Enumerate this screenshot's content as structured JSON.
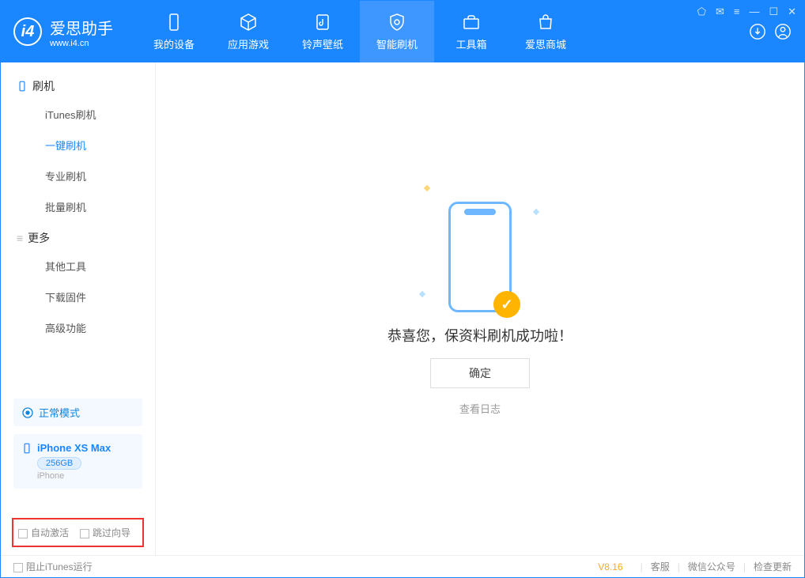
{
  "app": {
    "name": "爱思助手",
    "url": "www.i4.cn"
  },
  "tabs": [
    {
      "label": "我的设备"
    },
    {
      "label": "应用游戏"
    },
    {
      "label": "铃声壁纸"
    },
    {
      "label": "智能刷机"
    },
    {
      "label": "工具箱"
    },
    {
      "label": "爱思商城"
    }
  ],
  "sidebar": {
    "group1": "刷机",
    "items1": [
      "iTunes刷机",
      "一键刷机",
      "专业刷机",
      "批量刷机"
    ],
    "group2": "更多",
    "items2": [
      "其他工具",
      "下载固件",
      "高级功能"
    ]
  },
  "mode": {
    "label": "正常模式"
  },
  "device": {
    "name": "iPhone XS Max",
    "storage": "256GB",
    "type": "iPhone"
  },
  "options": {
    "auto_activate": "自动激活",
    "skip_guide": "跳过向导"
  },
  "main": {
    "success": "恭喜您，保资料刷机成功啦！",
    "ok": "确定",
    "view_log": "查看日志"
  },
  "status": {
    "stop_itunes": "阻止iTunes运行",
    "version": "V8.16",
    "service": "客服",
    "wechat": "微信公众号",
    "check_update": "检查更新"
  }
}
